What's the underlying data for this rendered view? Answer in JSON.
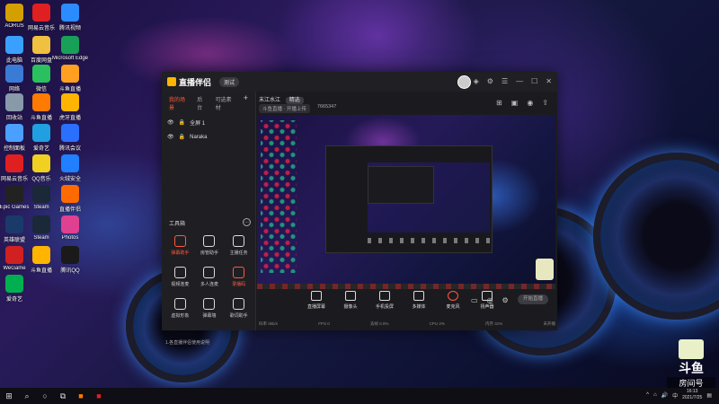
{
  "desktop": {
    "icons": [
      {
        "label": "AORUS",
        "color": "#d4a000"
      },
      {
        "label": "网易云音乐",
        "color": "#e02020"
      },
      {
        "label": "腾讯视频",
        "color": "#2b8cff"
      },
      {
        "label": "此电脑",
        "color": "#3aa0ff"
      },
      {
        "label": "百度网盘",
        "color": "#f0c040"
      },
      {
        "label": "Microsoft Edge",
        "color": "#18a058"
      },
      {
        "label": "网络",
        "color": "#3a7bd5"
      },
      {
        "label": "微信",
        "color": "#2ac060"
      },
      {
        "label": "斗鱼直播",
        "color": "#ffa020"
      },
      {
        "label": "回收站",
        "color": "#8899aa"
      },
      {
        "label": "斗鱼直播",
        "color": "#ff7a00"
      },
      {
        "label": "虎牙直播",
        "color": "#ffb400"
      },
      {
        "label": "控制面板",
        "color": "#4aa0ff"
      },
      {
        "label": "爱奇艺",
        "color": "#20a0e0"
      },
      {
        "label": "腾讯会议",
        "color": "#2b6fff"
      },
      {
        "label": "网易云音乐",
        "color": "#e02020"
      },
      {
        "label": "QQ音乐",
        "color": "#f0d020"
      },
      {
        "label": "火绒安全",
        "color": "#2080ff"
      },
      {
        "label": "Epic Games",
        "color": "#222222"
      },
      {
        "label": "Steam",
        "color": "#1b2838"
      },
      {
        "label": "直播伴侣",
        "color": "#ff6a00"
      },
      {
        "label": "英雄联盟",
        "color": "#1a3a6a"
      },
      {
        "label": "Steam",
        "color": "#1b2838"
      },
      {
        "label": "Photos",
        "color": "#e04090"
      },
      {
        "label": "WeGame",
        "color": "#d02020"
      },
      {
        "label": "斗鱼直播",
        "color": "#ffb400"
      },
      {
        "label": "腾讯QQ",
        "color": "#1a1a1a"
      },
      {
        "label": "爱奇艺",
        "color": "#00b050"
      }
    ]
  },
  "app": {
    "title": "直播伴侣",
    "version": "测试",
    "scene_tabs": [
      "我的场景",
      "后台",
      "可选素材"
    ],
    "scenes": [
      {
        "name": "全屏 1"
      },
      {
        "name": "Naraka"
      }
    ],
    "tools_title": "工具箱",
    "tools": [
      {
        "label": "弹幕助手",
        "highlight": true
      },
      {
        "label": "房管助手",
        "highlight": false
      },
      {
        "label": "主播任务",
        "highlight": false
      },
      {
        "label": "视频连麦",
        "highlight": false
      },
      {
        "label": "多人连麦",
        "highlight": false
      },
      {
        "label": "录播码",
        "highlight": true
      },
      {
        "label": "虚拟形象",
        "highlight": false
      },
      {
        "label": "弹幕墙",
        "highlight": false
      },
      {
        "label": "歌词助手",
        "highlight": false
      }
    ],
    "bottom_note": "1.各直播伴侣使用说明",
    "room_title": "末江水江",
    "room_tag": "精选",
    "room_info": [
      "斗鱼直播 · 开播上传",
      "7665347"
    ],
    "controls": [
      {
        "label": "直播屏幕"
      },
      {
        "label": "摄像头"
      },
      {
        "label": "手机投屏"
      },
      {
        "label": "多媒体"
      },
      {
        "label": "麦克风"
      },
      {
        "label": "扬声器"
      }
    ],
    "start_label": "开始直播",
    "status": [
      "码率 0kb/s",
      "FPS 0",
      "丢帧 0.0%",
      "CPU 2%",
      "内存 31%",
      "未开播"
    ]
  },
  "overlay": {
    "brand": "斗鱼",
    "room_label": "房间号",
    "room_id": "7665347"
  },
  "taskbar": {
    "time": "16:13",
    "date": "2021/7/25",
    "ime": "中"
  }
}
